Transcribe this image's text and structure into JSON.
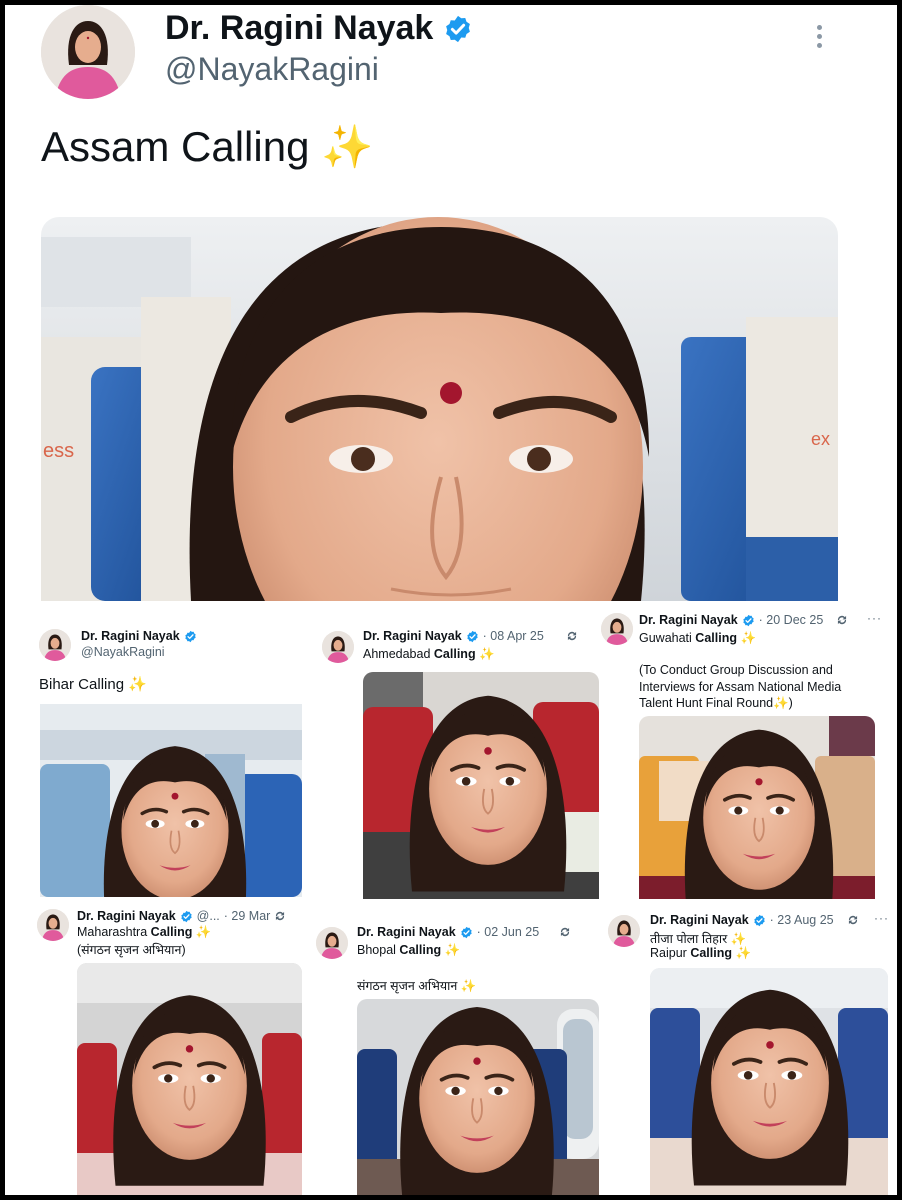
{
  "main": {
    "name": "Dr. Ragini Nayak",
    "handle": "@NayakRagini",
    "text": "Assam Calling ✨"
  },
  "tweets": [
    {
      "name": "Dr. Ragini Nayak",
      "handle": "@NayakRagini",
      "lines": [
        "Bihar Calling ✨"
      ]
    },
    {
      "name": "Dr. Ragini Nayak",
      "date": "· 08 Apr 25",
      "city": "Ahmedabad",
      "calling": "Calling",
      "emoji": "✨"
    },
    {
      "name": "Dr. Ragini Nayak",
      "date": "· 20 Dec 25",
      "city": "Guwahati",
      "calling": "Calling",
      "emoji": "✨",
      "lines": [
        "(To Conduct Group Discussion and",
        "Interviews for Assam National Media",
        "Talent Hunt Final Round✨)"
      ]
    },
    {
      "name": "Dr. Ragini Nayak",
      "handle": "@...",
      "date": "· 29 Mar",
      "city": "Maharashtra",
      "calling": "Calling",
      "emoji": "✨",
      "lines": [
        "(संगठन सृजन अभियान)"
      ]
    },
    {
      "name": "Dr. Ragini Nayak",
      "date": "· 02 Jun 25",
      "city": "Bhopal",
      "calling": "Calling",
      "emoji": "✨",
      "lines": [
        "संगठन सृजन अभियान ✨"
      ]
    },
    {
      "name": "Dr. Ragini Nayak",
      "date": "· 23 Aug 25",
      "city": "Raipur",
      "calling": "Calling",
      "emoji": "✨",
      "lines": [
        "तीजा पोला तिहार ✨"
      ]
    }
  ],
  "colors": {
    "verified": "#1d9bf0",
    "text": "#0f1419",
    "muted": "#536471",
    "seat_blue": "#2c5fa8",
    "seat_red": "#b8262e",
    "sky_blue": "#8ec7ec"
  }
}
